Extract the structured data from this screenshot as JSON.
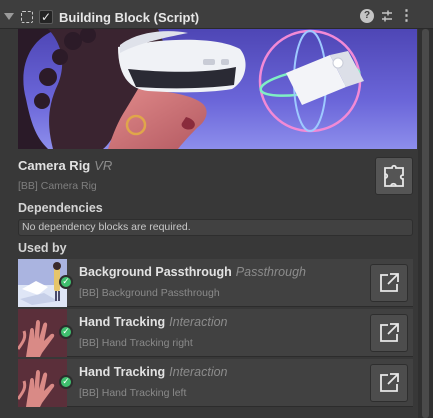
{
  "component": {
    "title": "Building Block (Script)",
    "enabled_mark": "✓",
    "help_glyph": "?",
    "menu_glyph": "⋮"
  },
  "block": {
    "name": "Camera Rig",
    "tag": "VR",
    "id": "[BB] Camera Rig"
  },
  "dependencies": {
    "label": "Dependencies",
    "message": "No dependency blocks are required."
  },
  "used_by": {
    "label": "Used by",
    "items": [
      {
        "name": "Background Passthrough",
        "tag": "Passthrough",
        "id": "[BB] Background Passthrough",
        "installed": true
      },
      {
        "name": "Hand Tracking",
        "tag": "Interaction",
        "id": "[BB] Hand Tracking right",
        "installed": true
      },
      {
        "name": "Hand Tracking",
        "tag": "Interaction",
        "id": "[BB] Hand Tracking left",
        "installed": true
      }
    ]
  },
  "icons": {
    "foldout": "triangle-down-icon",
    "script": "script-icon",
    "help": "help-icon",
    "presets": "sliders-icon",
    "menu": "kebab-menu-icon",
    "assemble": "puzzle-icon",
    "open": "external-link-icon",
    "installed": "check-circle-icon"
  },
  "colors": {
    "background": "#383838",
    "header": "#3e3e3e",
    "panel": "#414141",
    "installed_badge": "#3fbf6e",
    "banner_top": "#4f47b8",
    "banner_bottom": "#8a8bea"
  }
}
